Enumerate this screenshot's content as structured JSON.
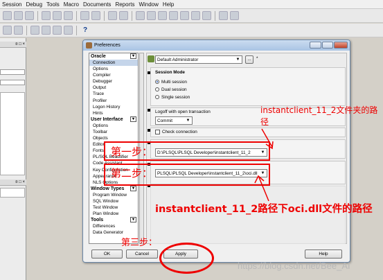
{
  "menu": [
    "Session",
    "Debug",
    "Tools",
    "Macro",
    "Documents",
    "Reports",
    "Window",
    "Help"
  ],
  "dialog": {
    "title": "Preferences",
    "profile": "Default Administrator",
    "profile_extra": "*",
    "more_button": "...",
    "tree": {
      "oracle": {
        "label": "Oracle",
        "items": [
          "Connection",
          "Options",
          "Compiler",
          "Debugger",
          "Output",
          "Trace",
          "Profiler",
          "Logon History",
          "Hints"
        ]
      },
      "user_interface": {
        "label": "User Interface",
        "items": [
          "Options",
          "Toolbar",
          "Objects",
          "Editor",
          "Fonts",
          "PL/SQL Beautifier",
          "Code Assistant",
          "Key Configuration",
          "Appearance",
          "NLS Options"
        ]
      },
      "window_types": {
        "label": "Window Types",
        "items": [
          "Program Window",
          "SQL Window",
          "Test Window",
          "Plan Window"
        ]
      },
      "tools": {
        "label": "Tools",
        "items": [
          "Differences",
          "Data Generator"
        ]
      }
    },
    "session_mode": {
      "title": "Session Mode",
      "options": [
        "Multi session",
        "Dual session",
        "Single session"
      ],
      "selected": "Multi session"
    },
    "logoff": {
      "title": "Logoff with open transaction",
      "value": "Commit"
    },
    "check_connection": "Check connection",
    "oracle_home_value": "D:\\PLSQL\\PLSQL Developer\\instantclient_11_2",
    "oci_library_value": "PLSQL\\PLSQL Developer\\instantclient_11_2\\oci.dll",
    "buttons": {
      "ok": "OK",
      "cancel": "Cancel",
      "apply": "Apply",
      "help": "Help"
    }
  },
  "annotations": {
    "step1": "第一步：",
    "step2": "第二步：",
    "step3": "第三步：",
    "note_top": "instantclient_11_2文件夹的路径",
    "note_bottom": "instantclient_11_2路径下oci.dll文件的路径"
  },
  "watermark": "https://blog.csdn.net/Bee_AI",
  "left_pane": {
    "header_labels": [
      "¤ □ ×",
      "¤ □ ×"
    ]
  }
}
